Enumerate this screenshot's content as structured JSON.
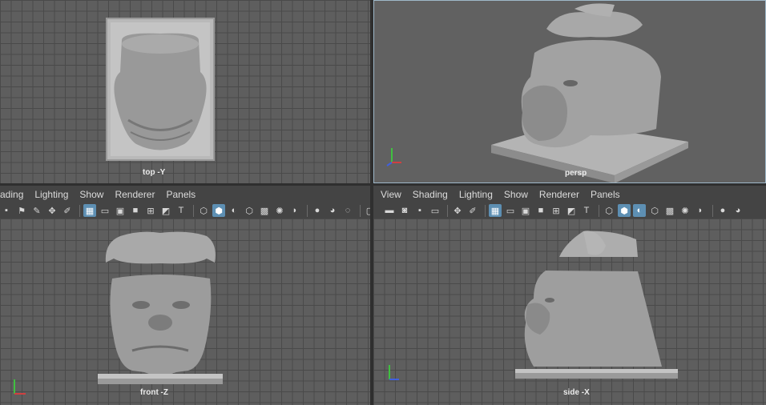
{
  "viewports": {
    "top": {
      "label": "top -Y"
    },
    "persp": {
      "label": "persp"
    },
    "front": {
      "label": "front -Z"
    },
    "side": {
      "label": "side -X"
    }
  },
  "left_panel_menu": [
    "ading",
    "Lighting",
    "Show",
    "Renderer",
    "Panels"
  ],
  "right_panel_menu": [
    "View",
    "Shading",
    "Lighting",
    "Show",
    "Renderer",
    "Panels"
  ],
  "toolbar_icons": {
    "left": [
      "marker-icon",
      "bookmark-icon",
      "camera-attrib-icon",
      "move-tool-icon",
      "paint-icon",
      "sep",
      "grid-icon",
      "film-gate-icon",
      "resolution-gate-icon",
      "gate-mask-icon",
      "field-chart-icon",
      "safe-action-icon",
      "safe-title-icon",
      "sep",
      "wireframe-icon",
      "smooth-shade-icon",
      "shade-wire-icon",
      "xray-icon",
      "textured-icon",
      "lights-icon",
      "shadows-icon",
      "sep",
      "ambient-occlusion-icon",
      "motion-blur-icon",
      "anti-alias-icon",
      "sep",
      "isolate-icon"
    ],
    "right": [
      "select-camera-icon",
      "camera-icon",
      "lock-camera-icon",
      "image-plane-icon",
      "sep",
      "move-tool-icon",
      "paint-icon",
      "sep",
      "grid-icon",
      "film-gate-icon",
      "resolution-gate-icon",
      "gate-mask-icon",
      "field-chart-icon",
      "safe-action-icon",
      "safe-title-icon",
      "sep",
      "wireframe-icon",
      "smooth-shade-icon",
      "shade-wire-icon",
      "xray-icon",
      "textured-icon",
      "lights-icon",
      "shadows-icon",
      "sep",
      "ambient-occlusion-icon",
      "motion-blur-icon"
    ]
  },
  "axes": {
    "x_color": "#d04040",
    "y_color": "#40c040",
    "z_color": "#4060e0"
  }
}
